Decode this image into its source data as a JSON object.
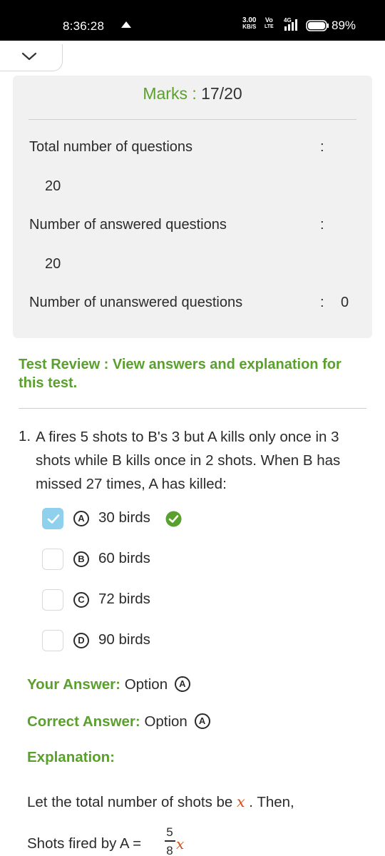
{
  "status_bar": {
    "time": "8:36:28",
    "net_speed_value": "3.00",
    "net_speed_unit": "KB/S",
    "volte_top": "Vo",
    "volte_bottom": "LTE",
    "network": "4G",
    "battery": "89%"
  },
  "summary": {
    "marks_label": "Marks :",
    "marks_value": "17/20",
    "rows": [
      {
        "label": "Total number of questions",
        "colon": ":",
        "value": "20"
      },
      {
        "label": "Number of answered questions",
        "colon": ":",
        "value": "20"
      },
      {
        "label": "Number of unanswered questions",
        "colon": ":",
        "value": "0"
      }
    ]
  },
  "review_heading": "Test Review : View answers and explanation for this test.",
  "question": {
    "number": "1.",
    "text": "A fires 5 shots to B's 3 but A kills only once in 3 shots while B kills once in 2 shots. When B has missed 27 times, A has killed:",
    "options": [
      {
        "letter": "A",
        "text": "30 birds",
        "checked": true,
        "correct": true
      },
      {
        "letter": "B",
        "text": "60 birds",
        "checked": false,
        "correct": false
      },
      {
        "letter": "C",
        "text": "72 birds",
        "checked": false,
        "correct": false
      },
      {
        "letter": "D",
        "text": "90 birds",
        "checked": false,
        "correct": false
      }
    ],
    "your_answer_label": "Your Answer:",
    "your_answer_text": "Option",
    "your_answer_letter": "A",
    "correct_answer_label": "Correct Answer:",
    "correct_answer_text": "Option",
    "correct_answer_letter": "A",
    "explanation_label": "Explanation:",
    "explanation_line1_prefix": "Let the total number of shots be",
    "explanation_line1_var": "x",
    "explanation_line1_suffix": ". Then,",
    "explanation_line2_prefix": "Shots fired by A =",
    "explanation_line2_num": "5",
    "explanation_line2_den": "8",
    "explanation_line2_var": "x"
  },
  "colors": {
    "accent_green": "#5aa02c",
    "check_blue": "#8fd0ec",
    "math_orange": "#d0501e",
    "card_bg": "#f1f1f1"
  }
}
